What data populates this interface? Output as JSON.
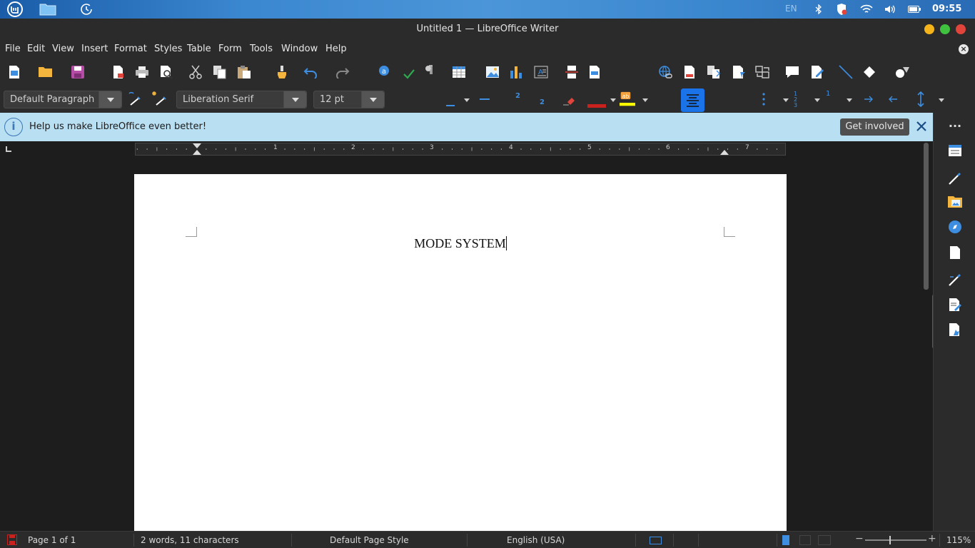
{
  "panel": {
    "keyboard_layout": "EN",
    "clock": "09:55"
  },
  "window": {
    "title": "Untitled 1 — LibreOffice Writer"
  },
  "menubar": {
    "items": [
      "File",
      "Edit",
      "View",
      "Insert",
      "Format",
      "Styles",
      "Table",
      "Form",
      "Tools",
      "Window",
      "Help"
    ]
  },
  "formatting": {
    "paragraph_style": "Default Paragraph Style",
    "font_name": "Liberation Serif",
    "font_size": "12 pt"
  },
  "infobar": {
    "message": "Help us make LibreOffice even better!",
    "button_label": "Get involved"
  },
  "ruler": {
    "numbers": [
      "1",
      "2",
      "3",
      "4",
      "5",
      "6",
      "7"
    ]
  },
  "document": {
    "text": "MODE SYSTEM"
  },
  "statusbar": {
    "page": "Page 1 of 1",
    "word_count": "2 words, 11 characters",
    "page_style": "Default Page Style",
    "language": "English (USA)",
    "zoom": "115%"
  },
  "colors": {
    "accent": "#1a73e8",
    "infobar_bg": "#b9dff3",
    "chrome_bg": "#2b2b2b",
    "close_red": "#e0443a",
    "min_yellow": "#f4b41a",
    "max_green": "#3fc33f"
  }
}
